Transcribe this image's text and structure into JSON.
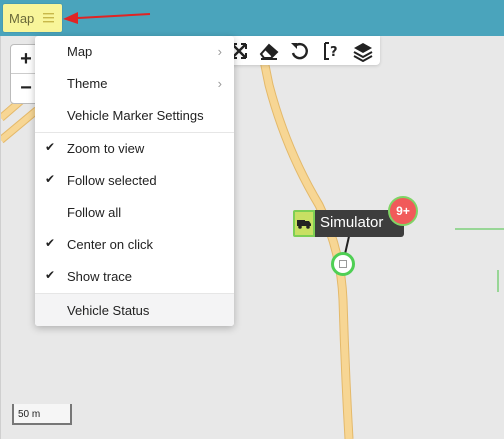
{
  "topbar": {
    "map_label": "Map"
  },
  "zoom": {
    "in_label": "+",
    "out_label": "−"
  },
  "menu": {
    "items": [
      {
        "label": "Map",
        "checked": false,
        "submenu": true
      },
      {
        "label": "Theme",
        "checked": false,
        "submenu": true
      },
      {
        "label": "Vehicle Marker Settings",
        "checked": false,
        "submenu": false
      },
      {
        "label": "Zoom to view",
        "checked": true,
        "submenu": false
      },
      {
        "label": "Follow selected",
        "checked": true,
        "submenu": false
      },
      {
        "label": "Follow all",
        "checked": false,
        "submenu": false
      },
      {
        "label": "Center on click",
        "checked": true,
        "submenu": false
      },
      {
        "label": "Show trace",
        "checked": true,
        "submenu": false
      },
      {
        "label": "Vehicle Status",
        "checked": false,
        "submenu": false
      }
    ],
    "arrow_glyph": "›",
    "check_glyph": "✔"
  },
  "toolbar": {
    "icons": [
      "fullscreen-icon",
      "eraser-icon",
      "undo-icon",
      "help-icon",
      "layers-icon"
    ]
  },
  "vehicle": {
    "name": "Simulator",
    "badge": "9+"
  },
  "scale": {
    "label": "50 m"
  },
  "colors": {
    "topbar": "#4aa4bc",
    "map_button": "#f8f59a",
    "road": "#f7d694",
    "road_edge": "#e4b96a",
    "marker_green": "#4fcf54",
    "badge_red": "#f15a5a",
    "arrow_red": "#e02424"
  }
}
